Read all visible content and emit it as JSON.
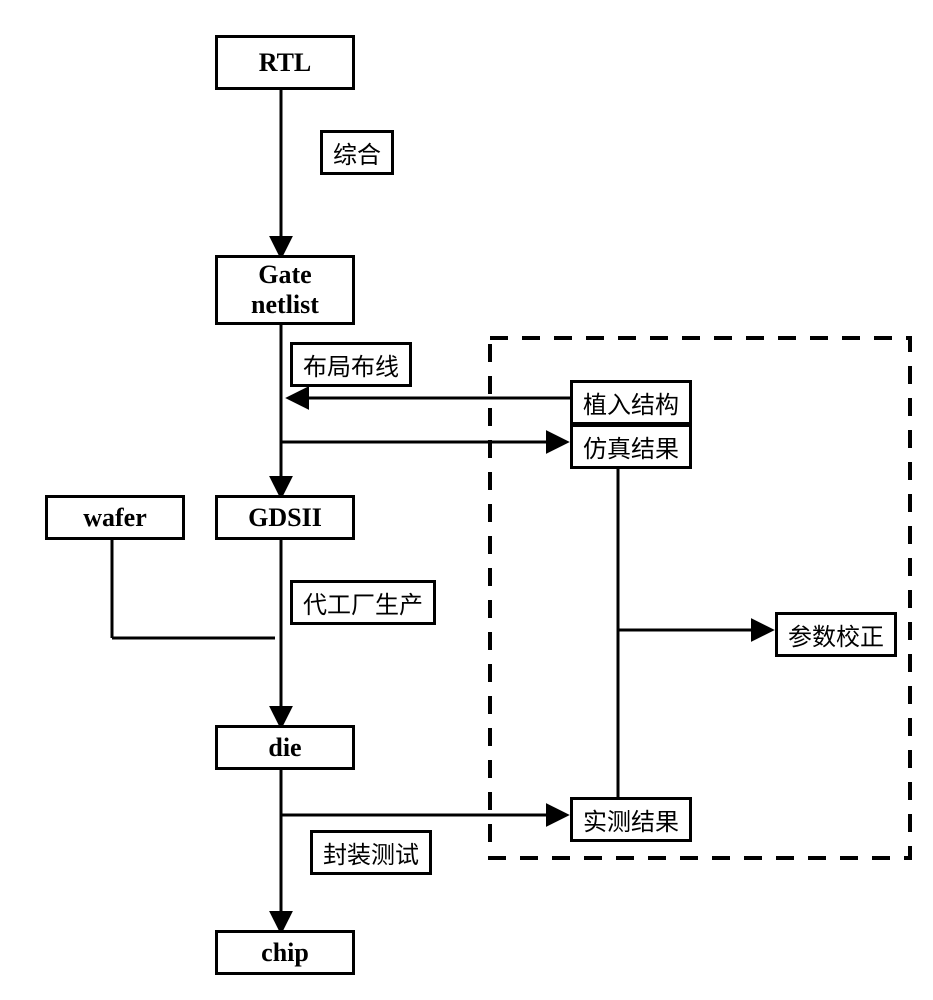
{
  "nodes": {
    "rtl": "RTL",
    "gate": "Gate\nnetlist",
    "gdsii": "GDSII",
    "wafer": "wafer",
    "die": "die",
    "chip": "chip"
  },
  "labels": {
    "synthesis": "综合",
    "pr": "布局布线",
    "implant": "植入结构",
    "sim": "仿真结果",
    "foundry": "代工厂生产",
    "paramcal": "参数校正",
    "measured": "实测结果",
    "pkgtest": "封装测试"
  }
}
